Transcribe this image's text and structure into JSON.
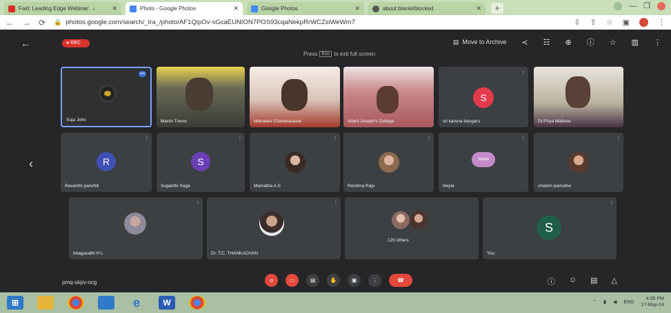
{
  "browser": {
    "tabs": [
      {
        "title": "Fwd: Leading Edge Webinar:  ‹",
        "favicon_color": "#d93025",
        "active": false
      },
      {
        "title": "Photo - Google Photos",
        "favicon_color": "#4285f4",
        "active": true
      },
      {
        "title": "Google Photos",
        "favicon_color": "#4285f4",
        "active": false
      },
      {
        "title": "about:blank#blocked",
        "favicon_color": "#555555",
        "active": false
      }
    ],
    "new_tab_label": "+",
    "url": "photos.google.com/search/_tra_/photo/AF1QipOv-sGcaEUNION7POS93cqaNekpRrWCZsiWeWm7"
  },
  "viewer": {
    "rec_label": "● REC",
    "fullscreen_hint": {
      "prefix": "Press",
      "key": "Esc",
      "suffix": "to exit full screen"
    },
    "move_to_archive": "Move to Archive",
    "icons": [
      "share-icon",
      "adjust-icon",
      "zoom-icon",
      "info-icon",
      "star-icon",
      "delete-icon",
      "more-icon"
    ]
  },
  "meet": {
    "code": "pmq-skpv-ocg",
    "participants_row1": [
      {
        "name": "Suja John",
        "type": "avatar-image",
        "color": "#c9a227"
      },
      {
        "name": "Martin Trevor",
        "type": "video",
        "color": "#5b5b45"
      },
      {
        "name": "Mahadev Chandrasekar",
        "type": "video",
        "color": "#a33a2c"
      },
      {
        "name": "Infant Joseph's College",
        "type": "video",
        "color": "#a8585c"
      },
      {
        "name": "sri karuna bangaru",
        "type": "letter",
        "letter": "S",
        "color": "#e53a4b"
      },
      {
        "name": "Dr.Priya Mathew",
        "type": "video",
        "color": "#b9b39f"
      }
    ],
    "participants_row2": [
      {
        "name": "Revanthi panchili",
        "type": "letter",
        "letter": "R",
        "color": "#3f51b5"
      },
      {
        "name": "Suganthi Suga",
        "type": "letter",
        "letter": "S",
        "color": "#6a3fb5"
      },
      {
        "name": "Mamatha A.S",
        "type": "photo",
        "color": "#8a6a5a"
      },
      {
        "name": "Reshma Raju",
        "type": "photo",
        "color": "#9a7a68"
      },
      {
        "name": "Neyla",
        "type": "photo",
        "color": "#c58bc9"
      },
      {
        "name": "shalom pamuthe",
        "type": "photo",
        "color": "#9a6a58"
      }
    ],
    "participants_row3": [
      {
        "name": "bhagavathi H L",
        "type": "photo",
        "color": "#8d8a9a"
      },
      {
        "name": "Dr. T.C. THANKACHAN",
        "type": "photo",
        "color": "#5a4a44"
      },
      {
        "name": "120 others",
        "type": "others",
        "color": "#8c6a62"
      },
      {
        "name": "You",
        "type": "letter",
        "letter": "S",
        "color": "#1e5e4a"
      }
    ]
  },
  "taskbar": {
    "apps": [
      {
        "name": "windows-start-icon",
        "label": "⊞",
        "color": "#2f79c9"
      },
      {
        "name": "file-explorer-icon",
        "label": "",
        "color": "#e2b53a"
      },
      {
        "name": "chrome-icon",
        "label": "",
        "color": "#d84a3a"
      },
      {
        "name": "calendar-app-icon",
        "label": "",
        "color": "#2f79c9"
      },
      {
        "name": "edge-icon",
        "label": "e",
        "color": "#2f79c9"
      },
      {
        "name": "word-icon",
        "label": "W",
        "color": "#2a5bb5"
      },
      {
        "name": "chrome-active-icon",
        "label": "",
        "color": "#d84a3a"
      }
    ],
    "lang": "ENG",
    "time": "4:06 PM",
    "date": "17-May-24"
  }
}
